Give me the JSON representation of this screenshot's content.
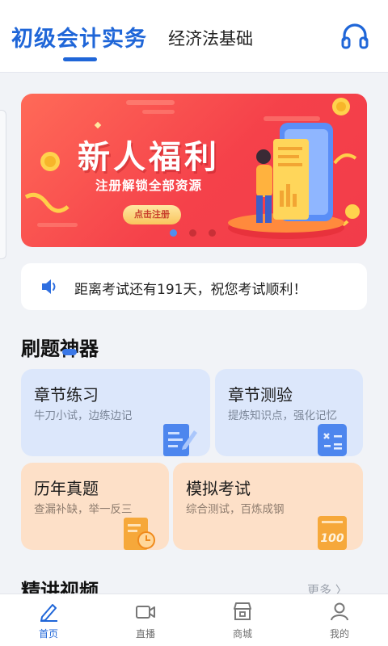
{
  "header": {
    "tab_active": "初级会计实务",
    "tab_inactive": "经济法基础"
  },
  "banner": {
    "title": "新人福利",
    "subtitle": "注册解锁全部资源",
    "button": "点击注册",
    "slides_total": 3,
    "active_slide": 1
  },
  "notice": {
    "text": "距离考试还有191天，祝您考试顺利！"
  },
  "practice": {
    "title": "刷题神器",
    "cards": [
      {
        "title": "章节练习",
        "desc": "牛刀小试，边练边记",
        "icon": "edit-document-icon"
      },
      {
        "title": "章节测验",
        "desc": "提炼知识点，强化记忆",
        "icon": "calculator-icon"
      },
      {
        "title": "历年真题",
        "desc": "查漏补缺，举一反三",
        "icon": "clock-document-icon"
      },
      {
        "title": "模拟考试",
        "desc": "综合测试，百炼成钢",
        "icon": "score-100-icon"
      }
    ]
  },
  "videos": {
    "title": "精讲视频",
    "more": "更多 〉"
  },
  "nav": [
    {
      "label": "首页",
      "icon": "pen-icon",
      "active": true
    },
    {
      "label": "直播",
      "icon": "video-camera-icon",
      "active": false
    },
    {
      "label": "商城",
      "icon": "store-icon",
      "active": false
    },
    {
      "label": "我的",
      "icon": "user-icon",
      "active": false
    }
  ],
  "colors": {
    "accent": "#1f66d8",
    "banner_red": "#f5414a",
    "card_blue": "#dce7fb",
    "card_orange": "#fde0c8"
  }
}
